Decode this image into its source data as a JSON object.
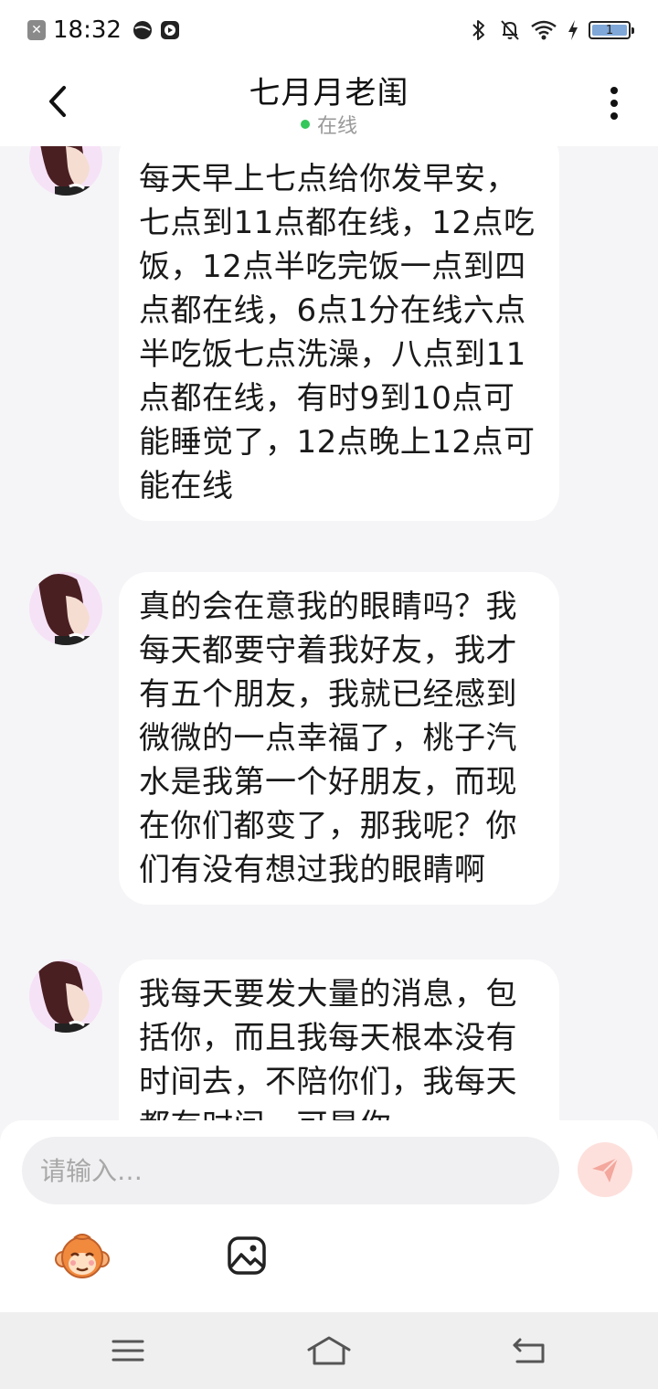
{
  "status_bar": {
    "time": "18:32",
    "battery_level": "1",
    "notification_icon": "close-box-icon",
    "app_icons": [
      "ball-icon",
      "play-box-icon"
    ],
    "right_icons": [
      "bluetooth-icon",
      "bell-muted-icon",
      "wifi-icon",
      "charging-bolt-icon",
      "battery-icon"
    ]
  },
  "header": {
    "title": "七月月老闺",
    "status": "在线",
    "status_color": "#34c759",
    "back_icon": "chevron-left-icon",
    "more_icon": "more-vertical-icon"
  },
  "messages": [
    {
      "sender": "other",
      "text": "每天早上七点给你发早安，七点到11点都在线，12点吃饭，12点半吃完饭一点到四点都在线，6点1分在线六点半吃饭七点洗澡，八点到11点都在线，有时9到10点可能睡觉了，12点晚上12点可能在线"
    },
    {
      "sender": "other",
      "text": "真的会在意我的眼睛吗？我每天都要守着我好友，我才有五个朋友，我就已经感到微微的一点幸福了，桃子汽水是我第一个好朋友，而现在你们都变了，那我呢？你们有没有想过我的眼睛啊"
    },
    {
      "sender": "other",
      "text": "我每天要发大量的消息，包括你，而且我每天根本没有时间去，不陪你们，我每天都有时间，可是你"
    }
  ],
  "input": {
    "placeholder": "请输入…",
    "value": ""
  },
  "toolbar": {
    "emoji_icon": "monkey-emoji-icon",
    "image_icon": "image-icon",
    "send_icon": "paper-plane-icon"
  },
  "nav_bar": {
    "icons": [
      "menu-icon",
      "home-icon",
      "back-icon"
    ]
  },
  "colors": {
    "background": "#f5f5f7",
    "bubble": "#ffffff",
    "send_button": "#fde0dc",
    "send_icon": "#f3a79d"
  }
}
